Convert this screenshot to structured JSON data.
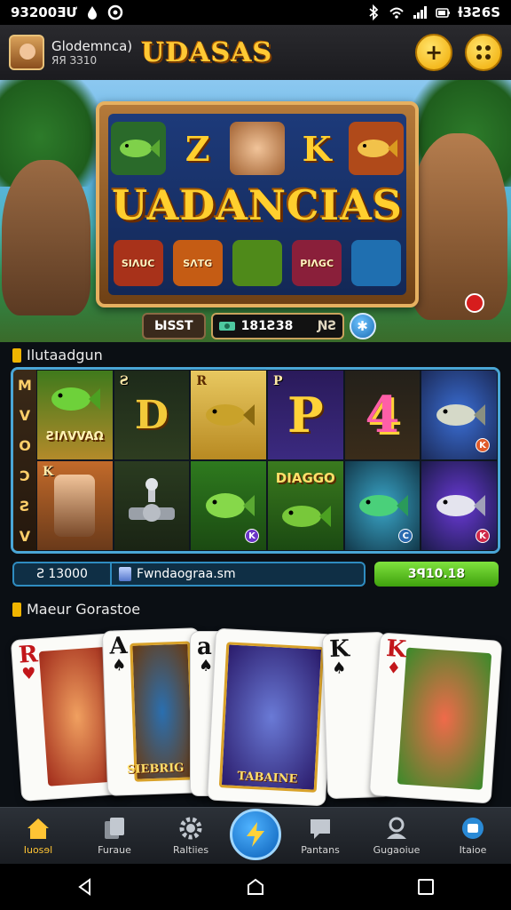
{
  "status_bar": {
    "time": "93200ƎƯ",
    "battery": "ƚ3Ƨ6S"
  },
  "header": {
    "user_name": "Glodemnca)",
    "user_sub": "ЯЯ ЗЗ10",
    "app_title": "UDASAS",
    "plus_label": "+",
    "menu_label": "∷"
  },
  "hero": {
    "banner_title": "UADANCIAS",
    "bet_label": "ЫSST",
    "balance_value": "181Ƨ38",
    "balance_unit": "ƝƧ",
    "info_label": "✱",
    "bottom_symbols": [
      "SIΛUC",
      "SΛTG",
      "",
      "PIΛGC",
      ""
    ]
  },
  "reels": {
    "section_label": "Ilutaadgun",
    "side_letters": [
      "M",
      "V",
      "O",
      "Ɔ",
      "Ƨ",
      "V"
    ],
    "cells": [
      {
        "text": "ƧIΛVVAΩ",
        "corner": ""
      },
      {
        "text": "D",
        "corner": "Ƨ"
      },
      {
        "text": "",
        "corner": "R"
      },
      {
        "text": "P",
        "corner": "P"
      },
      {
        "text": "4",
        "corner": ""
      },
      {
        "text": "",
        "corner": "K"
      },
      {
        "text": "",
        "corner": "K"
      },
      {
        "text": "",
        "corner": ""
      },
      {
        "text": "",
        "corner": ""
      },
      {
        "text": "DIAGGO",
        "corner": ""
      },
      {
        "text": "",
        "corner": ""
      },
      {
        "text": "",
        "corner": ""
      }
    ],
    "credit": "Ƨ 13000",
    "domain": "Fwndaograa.sm",
    "green_value": "3ꟼ10.18"
  },
  "cards_section": {
    "label": "Maeur Gorastoe",
    "cards": [
      {
        "rank": "R",
        "suit": "♥",
        "caption": ""
      },
      {
        "rank": "A",
        "suit": "♠",
        "caption": "SIEBRIG"
      },
      {
        "rank": "a",
        "suit": "♠",
        "caption": ""
      },
      {
        "rank": "",
        "suit": "",
        "caption": "TABAINE"
      },
      {
        "rank": "K",
        "suit": "♠",
        "caption": ""
      },
      {
        "rank": "K",
        "suit": "♦",
        "caption": ""
      }
    ]
  },
  "bottom_nav": {
    "items": [
      {
        "label": "Iuosɘl",
        "icon": "home-icon"
      },
      {
        "label": "Furaue",
        "icon": "cards-icon"
      },
      {
        "label": "Raltiies",
        "icon": "gear-icon"
      },
      {
        "label": "",
        "icon": "lightning-icon"
      },
      {
        "label": "Pantans",
        "icon": "chat-icon"
      },
      {
        "label": "Gugaoiue",
        "icon": "profile-icon"
      },
      {
        "label": "Itaioe",
        "icon": "badge-icon"
      }
    ]
  },
  "colors": {
    "accent_gold": "#ffc934",
    "accent_blue": "#4aa6d6",
    "accent_green": "#59c421"
  }
}
